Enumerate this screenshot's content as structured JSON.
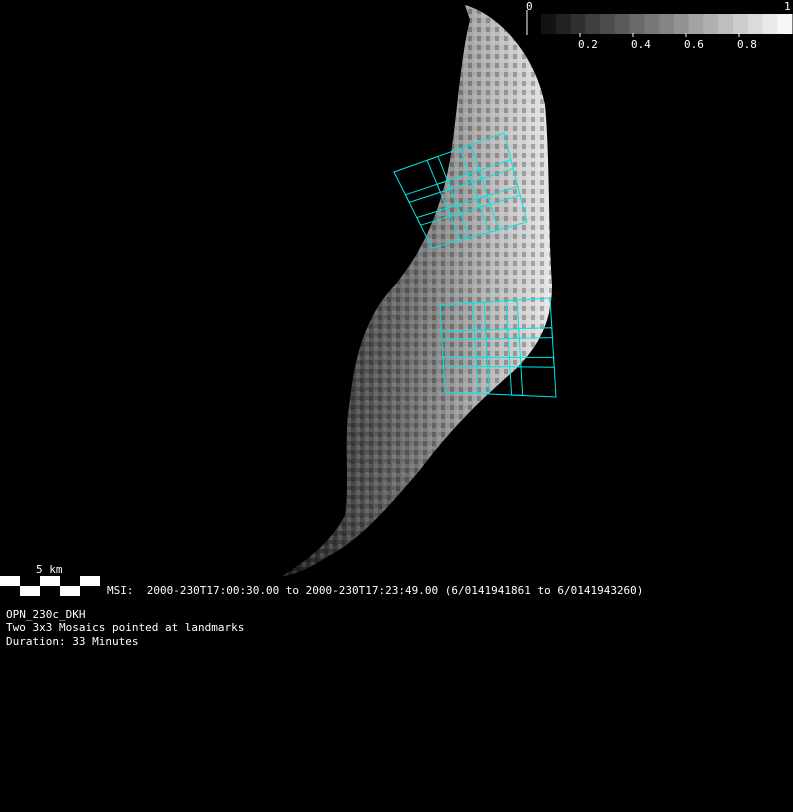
{
  "colorbar": {
    "min_label": "0",
    "max_label": "1",
    "tick_labels": [
      "0.2",
      "0.4",
      "0.6",
      "0.8"
    ],
    "tick_values": [
      0.2,
      0.4,
      0.6,
      0.8
    ],
    "steps": 17
  },
  "scale_bar": {
    "label": "5 km"
  },
  "observation": {
    "instrument_line": "MSI:  2000-230T17:00:30.00 to 2000-230T17:23:49.00 (6/0141941861 to 6/0141943260)",
    "sequence_id": "OPN_230c_DKH",
    "description": "Two 3x3 Mosaics pointed at landmarks",
    "duration": "Duration: 33 Minutes"
  },
  "colors": {
    "footprint": "#00e5e5",
    "background": "#000000"
  }
}
